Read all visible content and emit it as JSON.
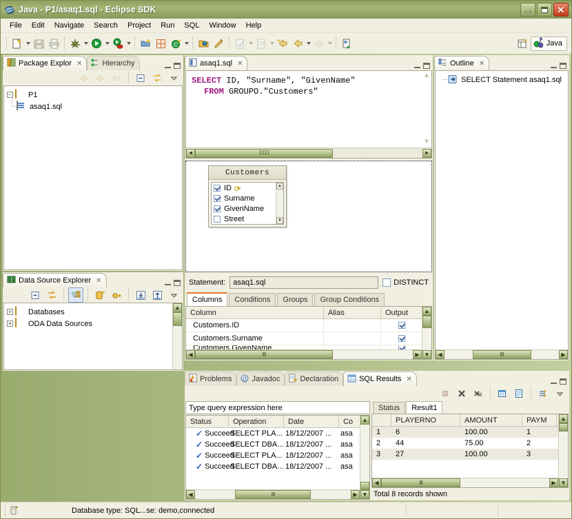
{
  "window": {
    "title": "Java - P1/asaq1.sql - Eclipse SDK",
    "app_icon": "eclipse-globe-icon",
    "minimize_label": "Minimize",
    "maximize_label": "Maximize",
    "close_label": "Close",
    "accent_titlebar": "#8fa05f",
    "accent_tab_selected": "#e07b2a",
    "accent_scrollbar": "#9aab6e"
  },
  "menubar": {
    "items": [
      {
        "label": "File",
        "mnemonic": "F"
      },
      {
        "label": "Edit",
        "mnemonic": "E"
      },
      {
        "label": "Navigate",
        "mnemonic": "N"
      },
      {
        "label": "Search",
        "mnemonic": "r"
      },
      {
        "label": "Project",
        "mnemonic": "P"
      },
      {
        "label": "Run",
        "mnemonic": "R"
      },
      {
        "label": "SQL",
        "mnemonic": "S"
      },
      {
        "label": "Window",
        "mnemonic": "W"
      },
      {
        "label": "Help",
        "mnemonic": "H"
      }
    ]
  },
  "toolbar": {
    "groups": [
      [
        "new-wizard-icon",
        "save-icon",
        "print-icon"
      ],
      [
        "debug-icon",
        "run-icon",
        "run-sql-icon"
      ],
      [
        "new-java-project-icon",
        "new-package-icon",
        "new-class-icon"
      ],
      [
        "open-type-icon",
        "search-icon"
      ],
      [
        "next-annotation-icon",
        "previous-annotation-icon",
        "back-icon",
        "forward-history-icon",
        "forward-icon"
      ],
      [
        "external-tools-icon"
      ]
    ],
    "perspective": {
      "open_perspective_label": "open-perspective-icon",
      "current_label": "Java",
      "current_icon": "java-perspective-icon"
    }
  },
  "package_explorer": {
    "tabs": [
      {
        "label": "Package Explor",
        "icon": "package-explorer-icon",
        "active": true,
        "closable": true
      },
      {
        "label": "Hierarchy",
        "icon": "hierarchy-icon",
        "active": false,
        "closable": false
      }
    ],
    "toolbar_icons": [
      "back-icon",
      "forward-icon",
      "up-icon",
      "collapse-all-icon",
      "link-with-editor-icon",
      "view-menu-icon"
    ],
    "tree": [
      {
        "label": "P1",
        "icon": "project-folder-icon",
        "expander": "-",
        "level": 0
      },
      {
        "label": "asaq1.sql",
        "icon": "sql-file-icon",
        "expander": "",
        "level": 1
      }
    ]
  },
  "data_source_explorer": {
    "tab": {
      "label": "Data Source Explorer",
      "icon": "data-source-explorer-icon",
      "closable": true
    },
    "toolbar_icons": [
      "collapse-all-icon",
      "link-with-editor-icon",
      "show-tree-icon",
      "new-connection-icon",
      "connect-icon",
      "import-icon",
      "export-icon",
      "view-menu-icon"
    ],
    "tree": [
      {
        "label": "Databases",
        "icon": "folder-icon",
        "expander": "+",
        "level": 0
      },
      {
        "label": "ODA Data Sources",
        "icon": "folder-icon",
        "expander": "+",
        "level": 0
      }
    ]
  },
  "editor": {
    "tab": {
      "label": "asaq1.sql",
      "icon": "sql-editor-icon",
      "closable": true
    },
    "code_lines": [
      {
        "keyword": "SELECT",
        "rest": " ID, \"Surname\", \"GivenName\"",
        "indent": 0
      },
      {
        "keyword": "FROM",
        "rest": " GROUPO.\"Customers\"",
        "indent": 1
      }
    ],
    "design": {
      "table": {
        "title": "Customers",
        "columns": [
          {
            "name": "ID",
            "checked": true,
            "key": true
          },
          {
            "name": "Surname",
            "checked": true,
            "key": false
          },
          {
            "name": "GivenName",
            "checked": true,
            "key": false
          },
          {
            "name": "Street",
            "checked": false,
            "key": false
          }
        ]
      }
    },
    "statement": {
      "label": "Statement:",
      "value": "asaq1.sql",
      "distinct_label": "DISTINCT",
      "distinct_checked": false
    },
    "lower_tabs": [
      {
        "label": "Columns",
        "active": true
      },
      {
        "label": "Conditions",
        "active": false
      },
      {
        "label": "Groups",
        "active": false
      },
      {
        "label": "Group Conditions",
        "active": false
      }
    ],
    "columns_grid": {
      "headers": [
        "Column",
        "Alias",
        "Output"
      ],
      "rows": [
        {
          "column": "Customers.ID",
          "alias": "",
          "output": true
        },
        {
          "column": "Customers.Surname",
          "alias": "",
          "output": true
        },
        {
          "column": "Customers.GivenName",
          "alias": "",
          "output": true
        }
      ]
    }
  },
  "outline": {
    "tab": {
      "label": "Outline",
      "icon": "outline-icon",
      "closable": true
    },
    "tree": [
      {
        "label": "SELECT Statement  asaq1.sql",
        "icon": "select-statement-icon"
      }
    ]
  },
  "bottom_panel": {
    "tabs": [
      {
        "label": "Problems",
        "icon": "problems-icon",
        "active": false,
        "closable": false
      },
      {
        "label": "Javadoc",
        "icon": "javadoc-icon",
        "active": false,
        "closable": false
      },
      {
        "label": "Declaration",
        "icon": "declaration-icon",
        "active": false,
        "closable": false
      },
      {
        "label": "SQL Results",
        "icon": "sql-results-icon",
        "active": true,
        "closable": true
      }
    ],
    "toolbar_icons": [
      "terminate-icon",
      "remove-icon",
      "remove-all-icon",
      "copy-icon",
      "new-document-icon",
      "scroll-lock-icon",
      "view-menu-icon"
    ],
    "query_input": {
      "placeholder": "Type query expression here",
      "value": "Type query expression here"
    },
    "status_grid": {
      "headers": [
        "Status",
        "Operation",
        "Date",
        "Co"
      ],
      "rows": [
        {
          "status": "Succeed",
          "operation": "SELECT PLA...",
          "date": "18/12/2007 ...",
          "connection": "asa",
          "icon": "success-check-icon"
        },
        {
          "status": "Succeed",
          "operation": "SELECT DBA...",
          "date": "18/12/2007 ...",
          "connection": "asa",
          "icon": "success-check-icon"
        },
        {
          "status": "Succeed",
          "operation": "SELECT PLA...",
          "date": "18/12/2007 ...",
          "connection": "asa",
          "icon": "success-check-icon"
        },
        {
          "status": "Succeed",
          "operation": "SELECT DBA...",
          "date": "18/12/2007 ...",
          "connection": "asa",
          "icon": "success-check-icon"
        }
      ]
    },
    "result_tabs": [
      {
        "label": "Status",
        "active": false
      },
      {
        "label": "Result1",
        "active": true
      }
    ],
    "result_grid": {
      "headers": [
        "",
        "PLAYERNO",
        "AMOUNT",
        "PAYM"
      ],
      "rows": [
        {
          "num": "1",
          "playerno": "6",
          "amount": "100.00",
          "paym": "1"
        },
        {
          "num": "2",
          "playerno": "44",
          "amount": "75.00",
          "paym": "2"
        },
        {
          "num": "3",
          "playerno": "27",
          "amount": "100.00",
          "paym": "3"
        }
      ]
    },
    "total_label": "Total 8 records shown"
  },
  "statusbar": {
    "icon": "database-connection-icon",
    "text": "Database type: SQL...se: demo,connected"
  }
}
